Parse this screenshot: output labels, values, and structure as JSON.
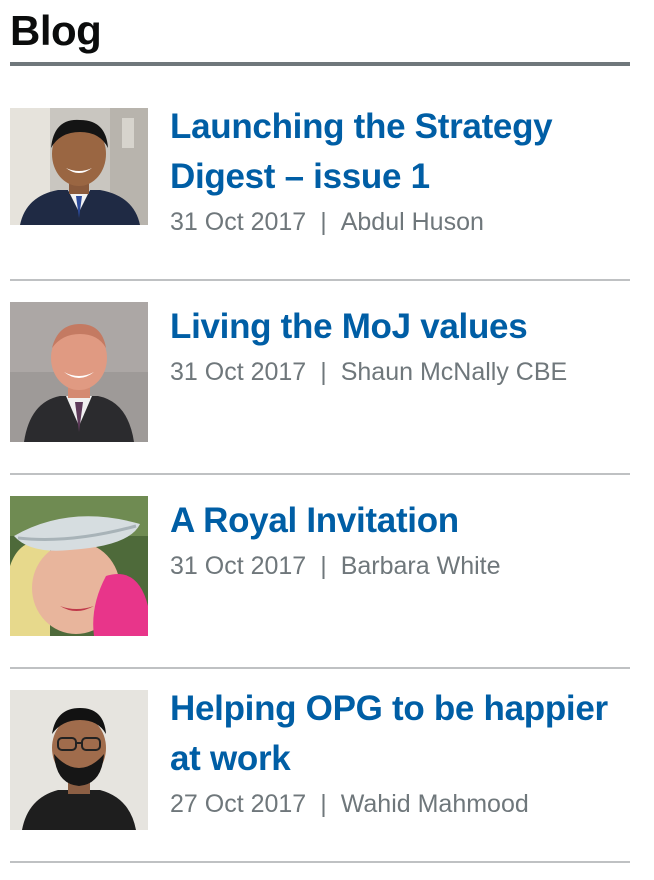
{
  "section": {
    "title": "Blog"
  },
  "posts": [
    {
      "title": "Launching the Strategy Digest – issue 1",
      "date": "31 Oct 2017",
      "separator": "|",
      "author": "Abdul Huson",
      "thumbnail_icon": "author-portrait"
    },
    {
      "title": "Living the MoJ values",
      "date": "31 Oct 2017",
      "separator": "|",
      "author": "Shaun McNally CBE",
      "thumbnail_icon": "author-portrait"
    },
    {
      "title": "A Royal Invitation",
      "date": "31 Oct 2017",
      "separator": "|",
      "author": "Barbara White",
      "thumbnail_icon": "author-portrait"
    },
    {
      "title": "Helping OPG to be happier at work",
      "date": "27 Oct 2017",
      "separator": "|",
      "author": "Wahid Mahmood",
      "thumbnail_icon": "author-portrait"
    }
  ],
  "colors": {
    "link": "#005ea5",
    "meta_text": "#6f777b",
    "heading_rule": "#6f777b",
    "divider": "#bfc1c3"
  }
}
